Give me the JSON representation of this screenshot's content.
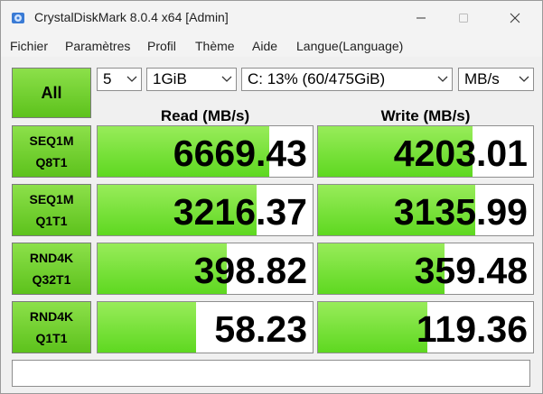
{
  "window": {
    "title": "CrystalDiskMark 8.0.4 x64 [Admin]",
    "accent": "#5dc21c"
  },
  "menu": [
    "Fichier",
    "Paramètres",
    "Profil",
    "Thème",
    "Aide",
    "Langue(Language)"
  ],
  "controls": {
    "all_label": "All",
    "count": "5",
    "size": "1GiB",
    "drive": "C: 13% (60/475GiB)",
    "unit": "MB/s"
  },
  "headers": {
    "read": "Read (MB/s)",
    "write": "Write (MB/s)"
  },
  "tests": [
    {
      "line1": "SEQ1M",
      "line2": "Q8T1",
      "read": "6669.43",
      "write": "4203.01",
      "read_fill": 0.8,
      "write_fill": 0.72
    },
    {
      "line1": "SEQ1M",
      "line2": "Q1T1",
      "read": "3216.37",
      "write": "3135.99",
      "read_fill": 0.74,
      "write_fill": 0.73
    },
    {
      "line1": "RND4K",
      "line2": "Q32T1",
      "read": "398.82",
      "write": "359.48",
      "read_fill": 0.6,
      "write_fill": 0.59
    },
    {
      "line1": "RND4K",
      "line2": "Q1T1",
      "read": "58.23",
      "write": "119.36",
      "read_fill": 0.46,
      "write_fill": 0.51
    }
  ],
  "comment": ""
}
